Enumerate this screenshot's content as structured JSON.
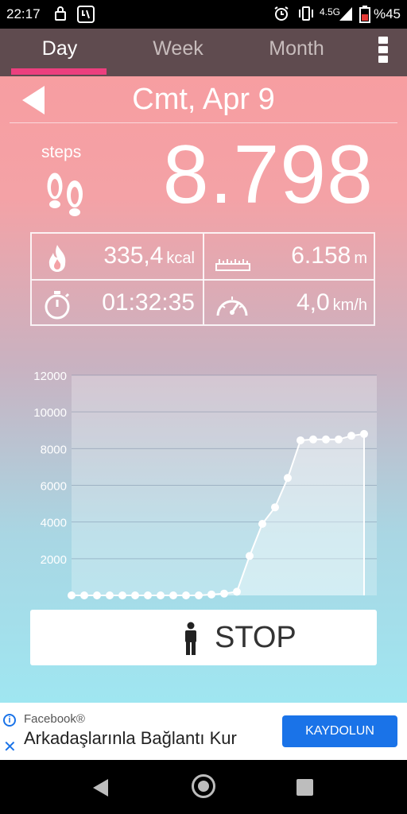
{
  "status_bar": {
    "time": "22:17",
    "network": "4.5G",
    "battery": "%45",
    "icons": [
      "lock-icon",
      "app-notification-icon",
      "alarm-icon",
      "vibrate-icon",
      "signal-icon",
      "battery-icon"
    ]
  },
  "tabs": [
    {
      "label": "Day",
      "active": true
    },
    {
      "label": "Week",
      "active": false
    },
    {
      "label": "Month",
      "active": false
    }
  ],
  "date": "Cmt, Apr 9",
  "steps": {
    "label": "steps",
    "value": "8.798"
  },
  "stats": {
    "calories": {
      "value": "335,4",
      "unit": "kcal",
      "icon": "flame-icon"
    },
    "distance": {
      "value": "6.158",
      "unit": "m",
      "icon": "ruler-icon"
    },
    "duration": {
      "value": "01:32:35",
      "icon": "stopwatch-icon"
    },
    "speed": {
      "value": "4,0",
      "unit": "km/h",
      "icon": "speedometer-icon"
    }
  },
  "chart_data": {
    "type": "area",
    "x": [
      0,
      1,
      2,
      3,
      4,
      5,
      6,
      7,
      8,
      9,
      10,
      11,
      12,
      13,
      14,
      15,
      16,
      17,
      18,
      19,
      20,
      21,
      22,
      23
    ],
    "values": [
      0,
      0,
      0,
      0,
      0,
      0,
      0,
      0,
      0,
      0,
      0,
      50,
      100,
      200,
      2150,
      3900,
      4800,
      6400,
      8450,
      8500,
      8500,
      8500,
      8700,
      8798
    ],
    "x_ticks": [
      "2",
      "4",
      "6",
      "8",
      "10",
      "12",
      "14",
      "16",
      "18",
      "20",
      "22",
      "24"
    ],
    "y_ticks": [
      "2000",
      "4000",
      "6000",
      "8000",
      "10000",
      "12000"
    ],
    "xlim": [
      0,
      24
    ],
    "ylim": [
      0,
      12000
    ],
    "grid": true
  },
  "stop_button": {
    "label": "STOP",
    "icon": "person-icon"
  },
  "ad": {
    "advertiser": "Facebook®",
    "headline": "Arkadaşlarınla Bağlantı Kur",
    "cta": "KAYDOLUN"
  }
}
